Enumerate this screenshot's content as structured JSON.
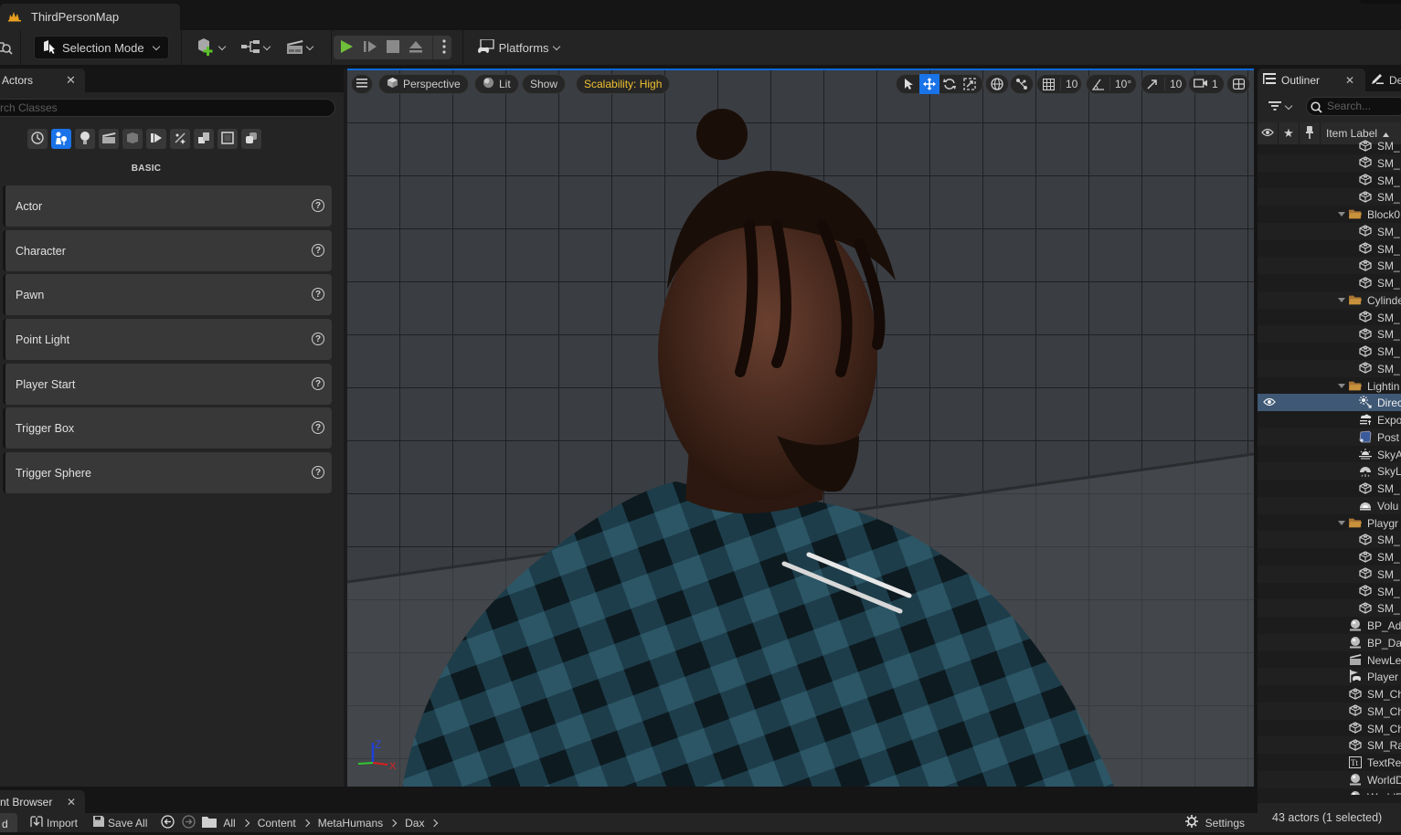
{
  "window": {
    "map_tab_title": "ThirdPersonMap"
  },
  "toolbar": {
    "selection_mode_label": "Selection Mode",
    "platforms_label": "Platforms"
  },
  "place_actors_panel": {
    "tab_label": "Actors",
    "search_placeholder": "rch Classes",
    "category_icons": [
      "recently-placed",
      "basic",
      "lights",
      "cinematic",
      "visual-effects",
      "volumes",
      "all-classes",
      "geometry",
      "shapes",
      "more"
    ],
    "active_category": "basic",
    "section_label": "BASIC",
    "items": [
      {
        "label": "Actor"
      },
      {
        "label": "Character"
      },
      {
        "label": "Pawn"
      },
      {
        "label": "Point Light"
      },
      {
        "label": "Player Start"
      },
      {
        "label": "Trigger Box"
      },
      {
        "label": "Trigger Sphere"
      }
    ]
  },
  "viewport": {
    "perspective_label": "Perspective",
    "lit_label": "Lit",
    "show_label": "Show",
    "scalability_label": "Scalability: High",
    "grid_snap_value": "10",
    "rotation_snap_value": "10°",
    "scale_snap_value": "10",
    "camera_speed_value": "1",
    "active_transform_tool": "translate",
    "axis_labels": {
      "z": "Z",
      "x": "X"
    }
  },
  "outliner": {
    "tab_label": "Outliner",
    "details_tab_label": "De",
    "search_placeholder": "Search...",
    "column_header": "Item Label",
    "rows": [
      {
        "label": "SM_",
        "type": "mesh",
        "depth": 2
      },
      {
        "label": "SM_",
        "type": "mesh",
        "depth": 2
      },
      {
        "label": "SM_",
        "type": "mesh",
        "depth": 2
      },
      {
        "label": "SM_",
        "type": "mesh",
        "depth": 2
      },
      {
        "label": "Block0",
        "type": "folder",
        "depth": 1
      },
      {
        "label": "SM_",
        "type": "mesh",
        "depth": 2
      },
      {
        "label": "SM_",
        "type": "mesh",
        "depth": 2
      },
      {
        "label": "SM_",
        "type": "mesh",
        "depth": 2
      },
      {
        "label": "SM_",
        "type": "mesh",
        "depth": 2
      },
      {
        "label": "Cylinde",
        "type": "folder",
        "depth": 1
      },
      {
        "label": "SM_",
        "type": "mesh",
        "depth": 2
      },
      {
        "label": "SM_",
        "type": "mesh",
        "depth": 2
      },
      {
        "label": "SM_",
        "type": "mesh",
        "depth": 2
      },
      {
        "label": "SM_",
        "type": "mesh",
        "depth": 2
      },
      {
        "label": "Lightin",
        "type": "folder",
        "depth": 1
      },
      {
        "label": "Direc",
        "type": "directional-light",
        "depth": 2,
        "selected": true
      },
      {
        "label": "Expo",
        "type": "exponential-fog",
        "depth": 2
      },
      {
        "label": "Post",
        "type": "post-process",
        "depth": 2
      },
      {
        "label": "SkyA",
        "type": "sky-atmosphere",
        "depth": 2
      },
      {
        "label": "SkyL",
        "type": "sky-light",
        "depth": 2
      },
      {
        "label": "SM_",
        "type": "mesh",
        "depth": 2
      },
      {
        "label": "Volu",
        "type": "volumetric-cloud",
        "depth": 2
      },
      {
        "label": "Playgr",
        "type": "folder",
        "depth": 1
      },
      {
        "label": "SM_",
        "type": "mesh",
        "depth": 2
      },
      {
        "label": "SM_",
        "type": "mesh",
        "depth": 2
      },
      {
        "label": "SM_",
        "type": "mesh",
        "depth": 2
      },
      {
        "label": "SM_",
        "type": "mesh",
        "depth": 2
      },
      {
        "label": "SM_",
        "type": "mesh",
        "depth": 2
      },
      {
        "label": "BP_Ad",
        "type": "blueprint",
        "depth": 0
      },
      {
        "label": "BP_Da",
        "type": "blueprint",
        "depth": 0
      },
      {
        "label": "NewLe",
        "type": "level-sequence",
        "depth": 0
      },
      {
        "label": "Player",
        "type": "player-start",
        "depth": 0
      },
      {
        "label": "SM_Ch",
        "type": "mesh",
        "depth": 0
      },
      {
        "label": "SM_Ch",
        "type": "mesh",
        "depth": 0
      },
      {
        "label": "SM_Ch",
        "type": "mesh",
        "depth": 0
      },
      {
        "label": "SM_Ra",
        "type": "mesh",
        "depth": 0
      },
      {
        "label": "TextRe",
        "type": "text-render",
        "depth": 0
      },
      {
        "label": "WorldD",
        "type": "blueprint",
        "depth": 0
      },
      {
        "label": "WorldF",
        "type": "blueprint",
        "depth": 0
      }
    ],
    "status": "43 actors (1 selected)"
  },
  "content_browser": {
    "tab_label": "nt Browser",
    "add_label": "d",
    "import_label": "Import",
    "save_all_label": "Save All",
    "breadcrumb": [
      "All",
      "Content",
      "MetaHumans",
      "Dax"
    ],
    "settings_label": "Settings"
  },
  "colors": {
    "accent_blue": "#1a73e8",
    "play_green": "#6fbf3a",
    "scalability_yellow": "#f0c030",
    "selected_row": "#3e5875",
    "folder": "#c8913c"
  }
}
